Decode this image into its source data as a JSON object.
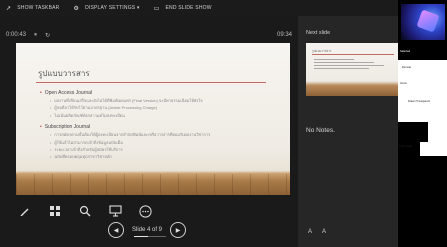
{
  "topbar": {
    "items": [
      {
        "icon": "arrow-up-icon",
        "glyph": "↗",
        "label": "SHOW TASKBAR"
      },
      {
        "icon": "display-settings-icon",
        "glyph": "⚙",
        "label": "DISPLAY SETTINGS ▾"
      },
      {
        "icon": "end-show-icon",
        "glyph": "▭",
        "label": "END SLIDE SHOW"
      }
    ]
  },
  "timer": {
    "elapsed": "0:00:43",
    "pause_glyph": "⏸",
    "restart_glyph": "↻",
    "clock": "09:34"
  },
  "slide": {
    "title": "รูปแบบวารสาร",
    "bullets": [
      {
        "level": 1,
        "text": "Open Access Journal"
      },
      {
        "level": 2,
        "text": "ผลงานที่เขียนเสร็จและยังไม่ได้ตีพิมพ์เผยแพร่ (Final Version) จะมีค่าธรรมเนียมให้ยังใจ"
      },
      {
        "level": 2,
        "text": "ผู้ขอดีลาให้รับไว้ตามมาตรฐาน (Article Processing Charge)"
      },
      {
        "level": 2,
        "text": "ไม่เน้นผลิตภัณฑ์ดังกล่าวแต่ไม่ลงทะเบียน"
      },
      {
        "level": 1,
        "text": "Subscription Journal"
      },
      {
        "level": 2,
        "text": "การสมัครตามขั้นต้องให้ผู้ลงทะเบียนจากสำนักพิมพ์และ/หรือวารสารที่ยอมรับผลงานวิชาการ"
      },
      {
        "level": 2,
        "text": "ผู้ใช้แล้วไม่สามารถเข้าถึงข้อมูลฉบับเต็ม"
      },
      {
        "level": 2,
        "text": "ระยะเวลาเข้าถึงสำหรับผู้สมัครใช้บริการ"
      },
      {
        "level": 2,
        "text": "ฉบับที่ครอบคลุมทุกสาขาวิชาหลัก"
      }
    ]
  },
  "tools": [
    {
      "name": "pen-icon",
      "glyph": "✎"
    },
    {
      "name": "see-all-slides-icon",
      "glyph": "▦"
    },
    {
      "name": "zoom-icon",
      "glyph": "⌕"
    },
    {
      "name": "screen-icon",
      "glyph": "⊟"
    },
    {
      "name": "more-options-icon",
      "glyph": "⋯"
    }
  ],
  "nav": {
    "prev_glyph": "◀",
    "next_glyph": "▶",
    "slide_counter": "Slide 4 of 9",
    "progress_fraction": 0.44
  },
  "next": {
    "label": "Next slide",
    "title": "รูปแบบวารสาร"
  },
  "notes": {
    "text": "No Notes."
  },
  "font_buttons": {
    "larger": "A",
    "smaller": "A"
  },
  "overlay": {
    "labels": [
      "Selected",
      "Remote",
      "Arrow",
      "Drawn Transparent",
      "Trans Solid"
    ]
  }
}
